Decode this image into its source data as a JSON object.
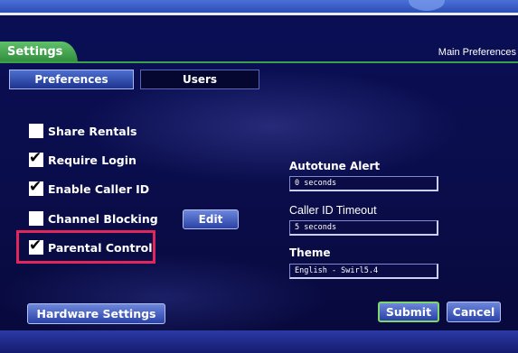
{
  "header": {
    "section_tab": "Settings",
    "page_title": "Main Preferences"
  },
  "tabs": [
    {
      "label": "Preferences",
      "active": true
    },
    {
      "label": "Users",
      "active": false
    }
  ],
  "options": [
    {
      "label": "Share Rentals",
      "checked": false
    },
    {
      "label": "Require Login",
      "checked": true
    },
    {
      "label": "Enable Caller ID",
      "checked": true
    },
    {
      "label": "Channel Blocking",
      "checked": false
    },
    {
      "label": "Parental Control",
      "checked": true
    }
  ],
  "check_mark": "✔",
  "buttons": {
    "edit": "Edit",
    "hardware": "Hardware Settings",
    "submit": "Submit",
    "cancel": "Cancel"
  },
  "fields": {
    "autotune_label": "Autotune Alert",
    "autotune_value": "0 seconds",
    "callerid_label": "Caller ID Timeout",
    "callerid_value": "5 seconds",
    "theme_label": "Theme",
    "theme_value": "English - Swirl5.4"
  },
  "colors": {
    "background": "#0a0f56",
    "settings_tab": "#3fa34d",
    "highlight": "#e0265a",
    "button": "#3f5bc0"
  }
}
